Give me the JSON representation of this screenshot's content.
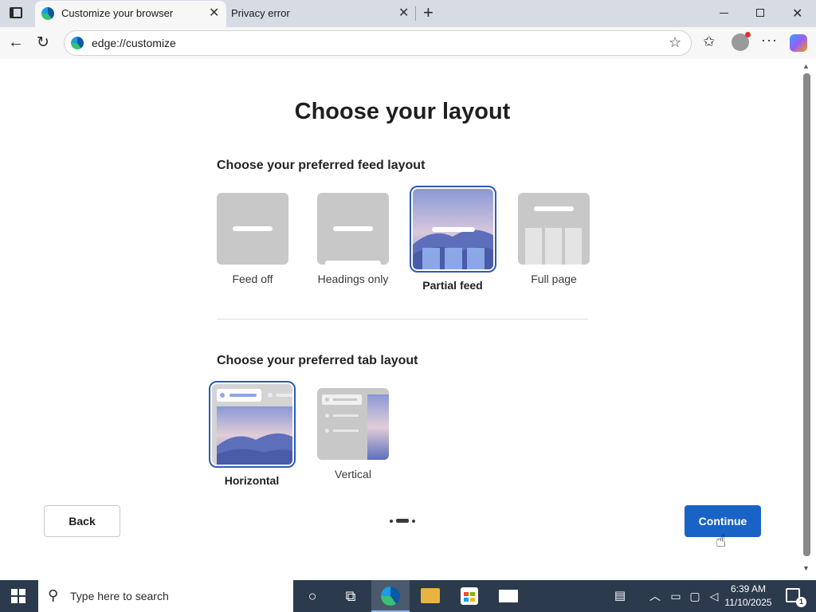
{
  "browser": {
    "tabs": [
      {
        "title": "Customize your browser",
        "active": true
      },
      {
        "title": "Privacy error",
        "active": false
      }
    ],
    "address": "edge://customize",
    "accent": "#1a63c6"
  },
  "page": {
    "title": "Choose your layout",
    "feed_heading": "Choose your preferred feed layout",
    "feed_options": [
      {
        "label": "Feed off",
        "selected": false
      },
      {
        "label": "Headings only",
        "selected": false
      },
      {
        "label": "Partial feed",
        "selected": true
      },
      {
        "label": "Full page",
        "selected": false
      }
    ],
    "tab_heading": "Choose your preferred tab layout",
    "tab_options": [
      {
        "label": "Horizontal",
        "selected": true
      },
      {
        "label": "Vertical",
        "selected": false
      }
    ],
    "back_label": "Back",
    "continue_label": "Continue",
    "step": {
      "current": 2,
      "total": 3
    }
  },
  "taskbar": {
    "search_placeholder": "Type here to search",
    "time": "6:39 AM",
    "date": "11/10/2025"
  }
}
